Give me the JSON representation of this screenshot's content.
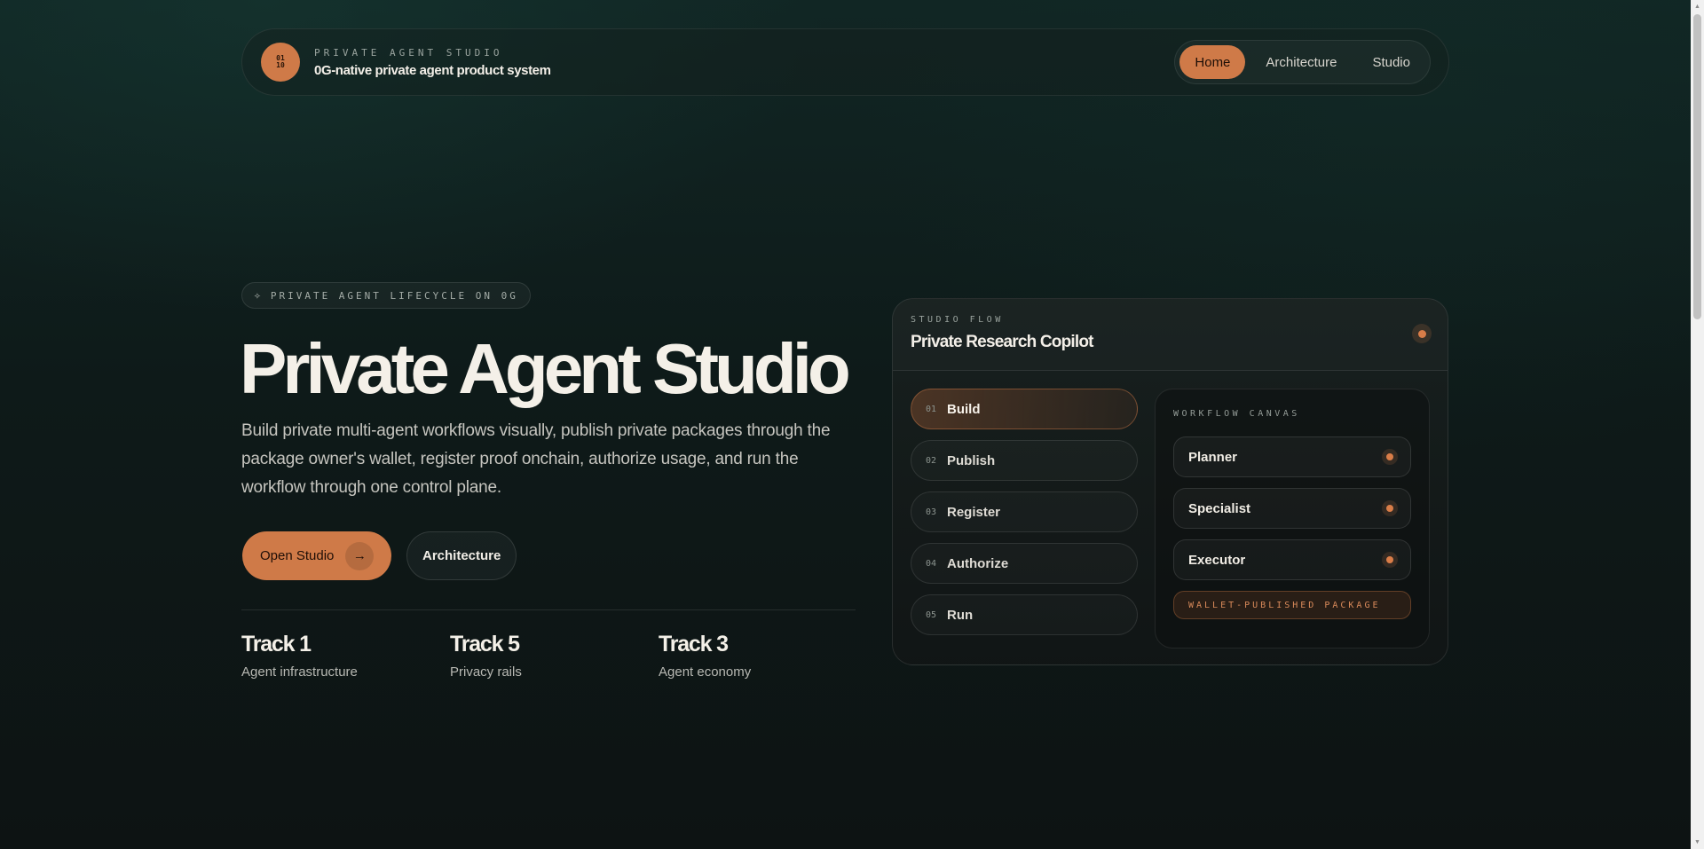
{
  "header": {
    "logo_text": "01\n10",
    "kicker": "PRIVATE AGENT STUDIO",
    "title": "0G-native private agent product system",
    "nav": [
      {
        "label": "Home",
        "active": true
      },
      {
        "label": "Architecture",
        "active": false
      },
      {
        "label": "Studio",
        "active": false
      }
    ]
  },
  "hero": {
    "pill_icon": "sparkle-icon",
    "pill_label": "PRIVATE AGENT LIFECYCLE ON 0G",
    "title": "Private Agent Studio",
    "subtitle": "Build private multi-agent workflows visually, publish private packages through the package owner's wallet, register proof onchain, authorize usage, and run the workflow through one control plane.",
    "primary_button": "Open Studio",
    "primary_icon": "arrow-right-icon",
    "secondary_button": "Architecture",
    "tracks": [
      {
        "title": "Track 1",
        "subtitle": "Agent infrastructure"
      },
      {
        "title": "Track 5",
        "subtitle": "Privacy rails"
      },
      {
        "title": "Track 3",
        "subtitle": "Agent economy"
      }
    ]
  },
  "studio_card": {
    "kicker": "STUDIO FLOW",
    "title": "Private Research Copilot",
    "steps": [
      {
        "num": "01",
        "label": "Build",
        "active": true
      },
      {
        "num": "02",
        "label": "Publish",
        "active": false
      },
      {
        "num": "03",
        "label": "Register",
        "active": false
      },
      {
        "num": "04",
        "label": "Authorize",
        "active": false
      },
      {
        "num": "05",
        "label": "Run",
        "active": false
      }
    ],
    "canvas": {
      "kicker": "WORKFLOW CANVAS",
      "agents": [
        "Planner",
        "Specialist",
        "Executor"
      ],
      "package_label": "WALLET-PUBLISHED PACKAGE"
    }
  },
  "colors": {
    "accent": "#cf7a48",
    "background": "#0f1b1a",
    "text": "#f3efe8"
  }
}
